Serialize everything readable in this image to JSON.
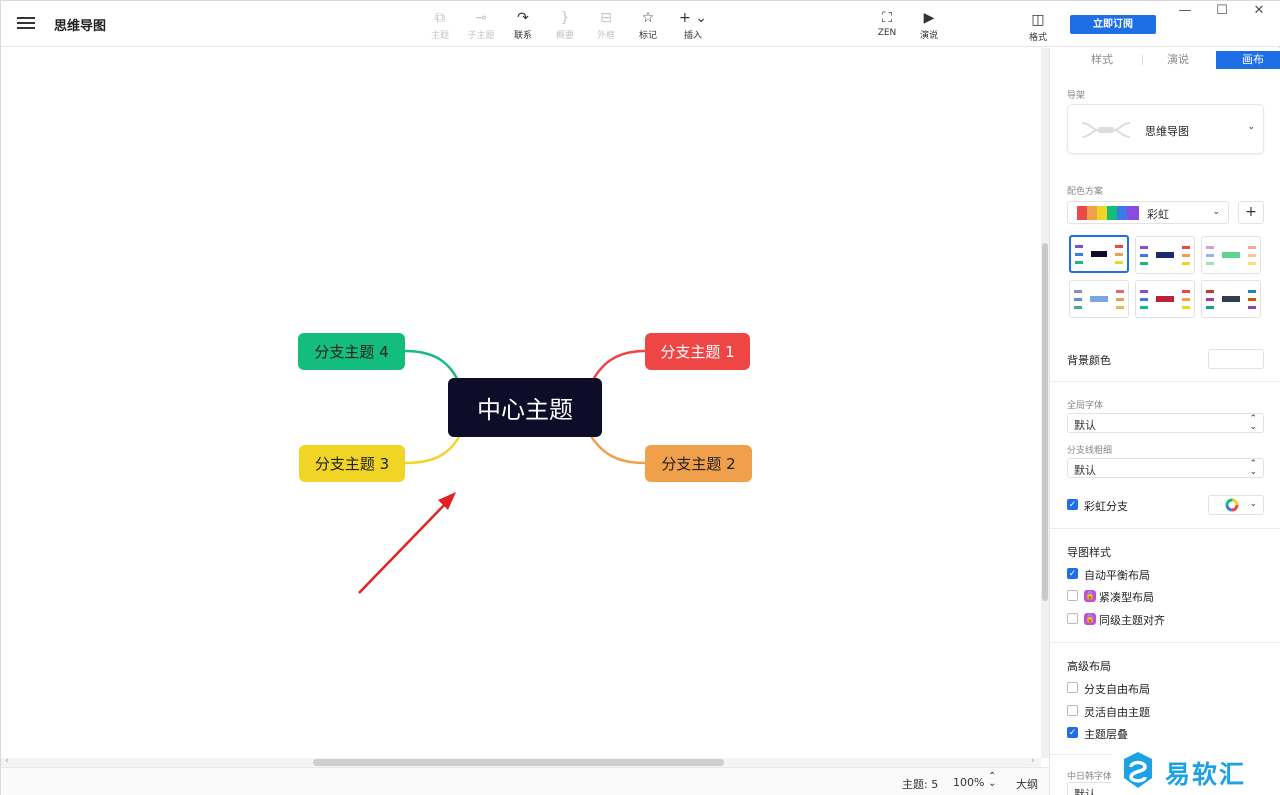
{
  "app": {
    "title": "思维导图"
  },
  "toolbar": {
    "topic": "主题",
    "subtopic": "子主题",
    "relation": "联系",
    "summary": "概要",
    "boundary": "外框",
    "marker": "标记",
    "insert": "插入",
    "zen": "ZEN",
    "present": "演说",
    "format": "格式",
    "subscribe": "立即订阅"
  },
  "map": {
    "center": "中心主题",
    "branches": [
      "分支主题 1",
      "分支主题 2",
      "分支主题 3",
      "分支主题 4"
    ],
    "branch_colors": [
      "#ee4545",
      "#f0a04b",
      "#f0d426",
      "#14bd7c"
    ],
    "center_color": "#0d0d2a"
  },
  "status": {
    "topics": "主题: 5",
    "zoom": "100%",
    "outline": "大纲"
  },
  "panel": {
    "tabs": [
      "样式",
      "演说",
      "画布"
    ],
    "active_tab": "画布",
    "structure_label": "导架",
    "structure_value": "思维导图",
    "color_scheme_label": "配色方案",
    "color_scheme_value": "彩虹",
    "add_label": "+",
    "background_label": "背景颜色",
    "font_label": "全局字体",
    "font_value": "默认",
    "line_label": "分支线粗细",
    "line_value": "默认",
    "rainbow_label": "彩虹分支",
    "map_style_title": "导图样式",
    "auto_balance": "自动平衡布局",
    "compact": "紧凑型布局",
    "align": "同级主题对齐",
    "advanced_title": "高级布局",
    "free_branch": "分支自由布局",
    "free_topic": "灵活自由主题",
    "overlap": "主题层叠",
    "cjk_font_label": "中日韩字体",
    "cjk_font_value": "默认"
  },
  "watermark": {
    "text": "易软汇"
  },
  "colors": {
    "accent": "#1e6fe6",
    "arrow": "#e02424"
  }
}
